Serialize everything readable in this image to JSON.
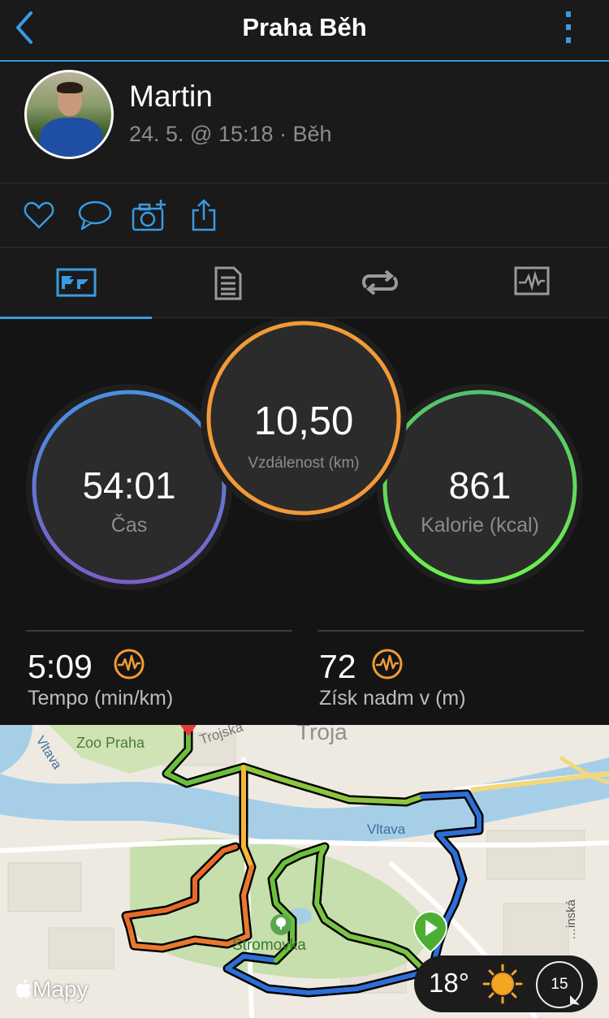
{
  "header": {
    "title": "Praha Běh"
  },
  "profile": {
    "name": "Martin",
    "meta": "24. 5. @ 15:18 · Běh"
  },
  "actions": [
    "heart-icon",
    "comment-icon",
    "camera-add-icon",
    "share-icon"
  ],
  "tabs": [
    {
      "icon": "overview-icon",
      "selected": true
    },
    {
      "icon": "details-list-icon",
      "selected": false
    },
    {
      "icon": "laps-icon",
      "selected": false
    },
    {
      "icon": "charts-icon",
      "selected": false
    }
  ],
  "stats": {
    "time": {
      "value": "54:01",
      "label": "Čas"
    },
    "distance": {
      "value": "10,50",
      "label": "Vzdálenost (km)"
    },
    "calories": {
      "value": "861",
      "label": "Kalorie (kcal)"
    }
  },
  "metrics": {
    "pace": {
      "value": "5:09",
      "label": "Tempo (min/km)"
    },
    "elevation": {
      "value": "72",
      "label": "Získ nadm v (m)"
    }
  },
  "map": {
    "labels": {
      "zoo": "Zoo Praha",
      "troja": "Troja",
      "trojska": "Trojská",
      "vltava_river": "Vltava",
      "vltava_left": "Vltava",
      "park": "Stromovka",
      "street": "…inská"
    },
    "attribution": "Mapy"
  },
  "weather": {
    "temperature": "18°",
    "condition": "sun-icon",
    "wind": "15"
  },
  "colors": {
    "accent": "#3a9be0",
    "time_ring": [
      "#4a90e2",
      "#7b5fc9"
    ],
    "distance_ring": "#f29a38",
    "calories_ring": [
      "#56c06c",
      "#6cf04b"
    ],
    "metric_icon": "#f29a38"
  }
}
